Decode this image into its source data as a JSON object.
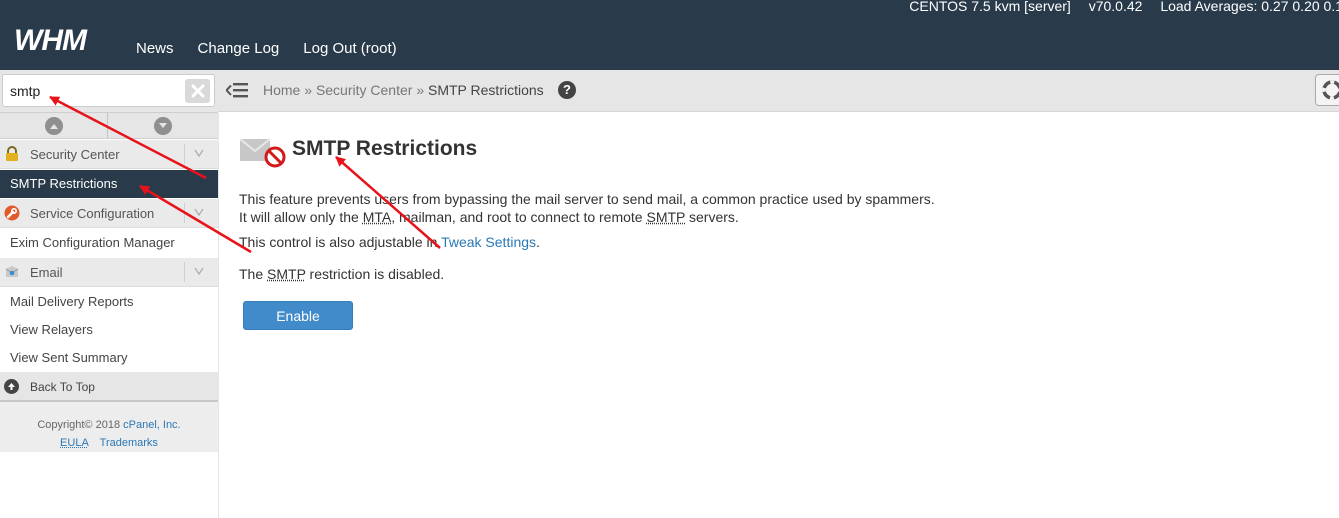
{
  "header": {
    "logo_text": "WHM",
    "server_os": "CENTOS 7.5 kvm [server]",
    "version": "v70.0.42",
    "load_averages": "Load Averages: 0.27 0.20 0.1",
    "nav": [
      "News",
      "Change Log",
      "Log Out (root)"
    ]
  },
  "sidebar": {
    "search_value": "smtp",
    "categories": {
      "security": "Security Center",
      "service": "Service Configuration",
      "email": "Email"
    },
    "items": {
      "smtp_restrictions": "SMTP Restrictions",
      "exim": "Exim Configuration Manager",
      "mail_delivery": "Mail Delivery Reports",
      "view_relayers": "View Relayers",
      "view_sent": "View Sent Summary"
    },
    "back_to_top": "Back To Top",
    "footer": {
      "copyright": "Copyright© 2018",
      "company": "cPanel, Inc.",
      "eula": "EULA",
      "trademarks": "Trademarks"
    }
  },
  "breadcrumb": {
    "home": "Home",
    "section": "Security Center",
    "current": "SMTP Restrictions",
    "separator": "»"
  },
  "main": {
    "title": "SMTP Restrictions",
    "line1": "This feature prevents users from bypassing the mail server to send mail, a common practice used by spammers.",
    "line2_pre": "It will allow only the ",
    "line2_mta": "MTA",
    "line2_mid": ", mailman, and root to connect to remote ",
    "line2_smtp": "SMTP",
    "line2_post": " servers.",
    "tweak_pre": "This control is also adjustable in ",
    "tweak_link": "Tweak Settings",
    "tweak_post": ".",
    "status_pre": "The ",
    "status_smtp": "SMTP",
    "status_post": " restriction is disabled.",
    "enable_label": "Enable"
  },
  "colors": {
    "header_bg": "#293a4a",
    "active_item_bg": "#293a4a",
    "link": "#2a78b5",
    "button": "#428bca",
    "annotation_arrow": "#e8121b"
  },
  "icons": [
    "lock-icon",
    "wrench-icon",
    "mail-icon",
    "search-clear-icon",
    "menu-toggle-icon",
    "help-icon",
    "smtp-blocked-icon",
    "up-circle-icon"
  ]
}
